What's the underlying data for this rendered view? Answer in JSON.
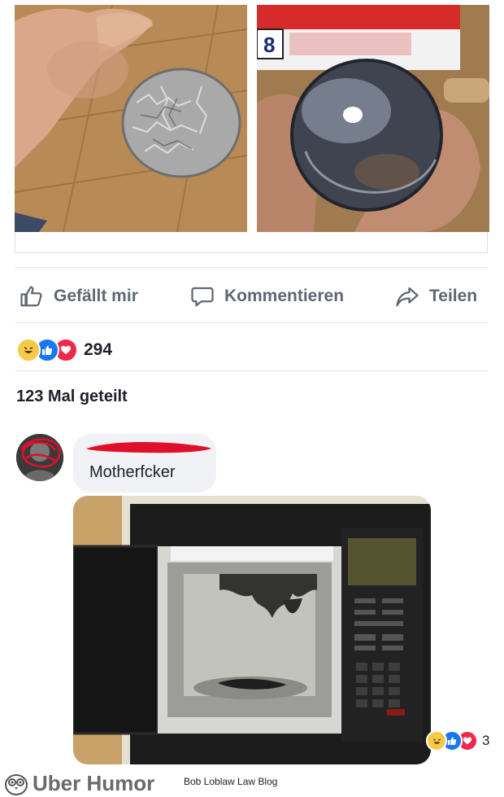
{
  "post": {
    "actions": {
      "like_label": "Gefällt mir",
      "comment_label": "Kommentieren",
      "share_label": "Teilen"
    },
    "reactions": {
      "icons": [
        "haha-reaction-icon",
        "like-reaction-icon",
        "love-reaction-icon"
      ],
      "count": "294"
    },
    "shares_text": "123 Mal geteilt"
  },
  "comment": {
    "text": "Motherfcker",
    "reactions": {
      "icons": [
        "haha-reaction-icon",
        "like-reaction-icon",
        "love-reaction-icon"
      ],
      "count": "3"
    }
  },
  "footer": {
    "brand": "Uber Humor",
    "blog": "Bob Loblaw Law Blog"
  },
  "colors": {
    "like_blue": "#1877f2",
    "love_red": "#f0284a",
    "haha_yellow": "#f7c948",
    "action_gray": "#606770",
    "bubble_gray": "#f0f2f5"
  }
}
